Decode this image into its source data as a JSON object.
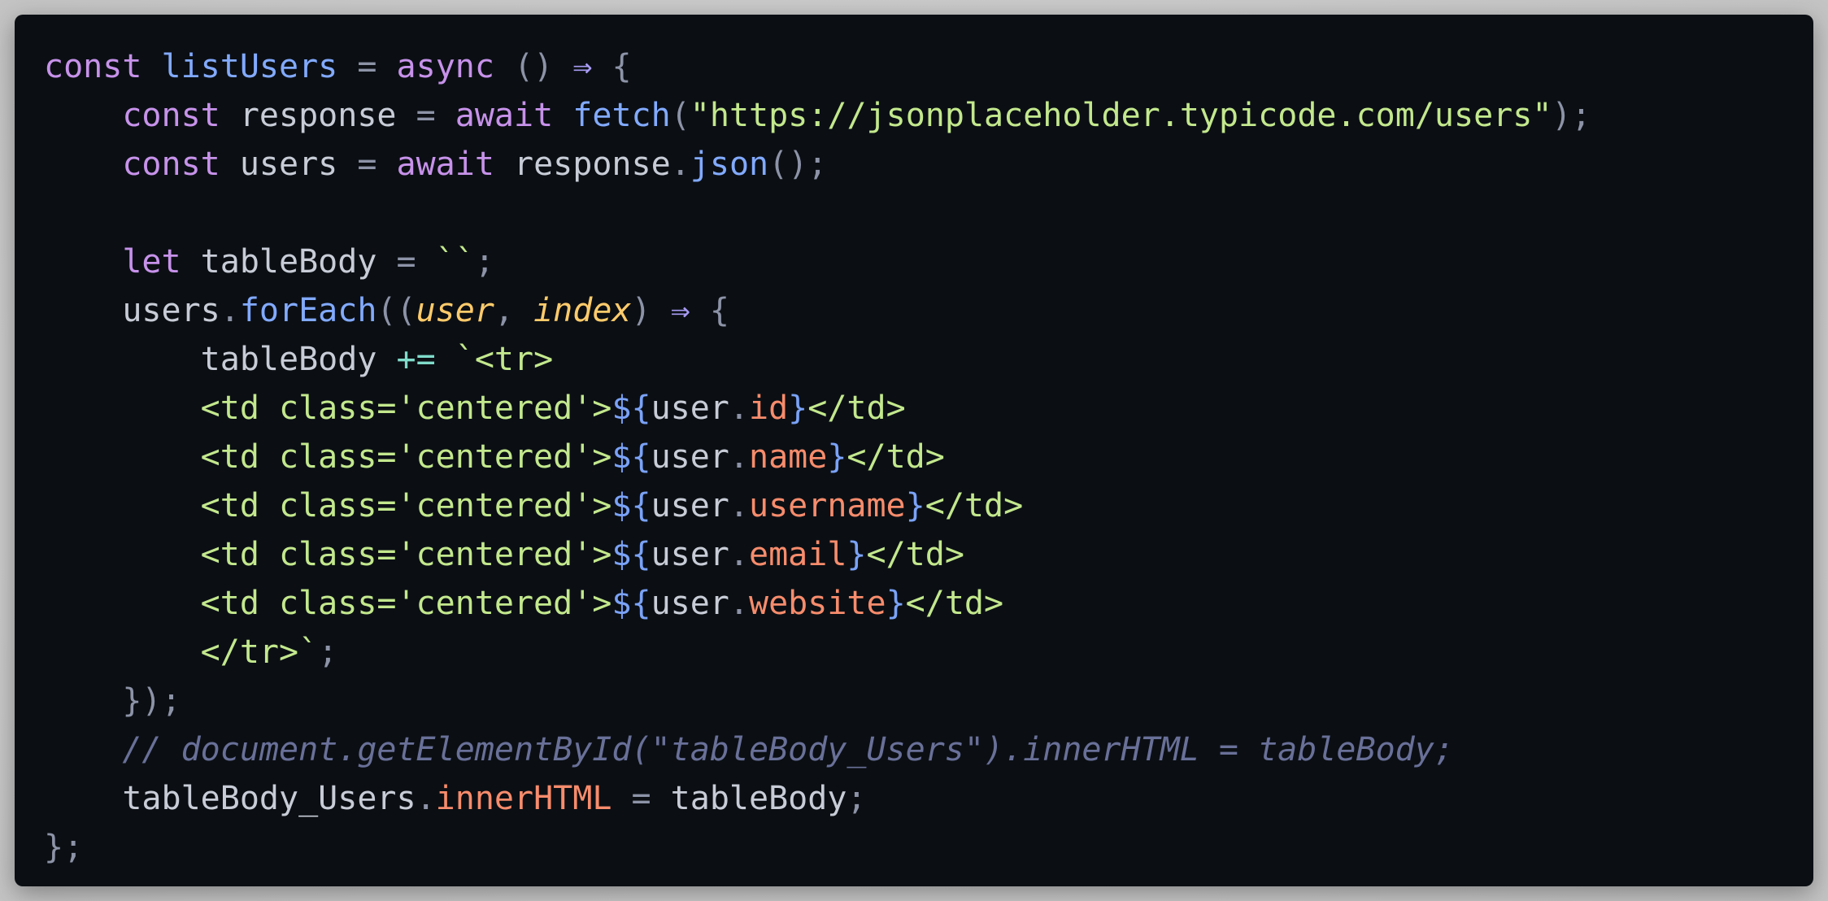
{
  "editor": {
    "language": "javascript",
    "colors": {
      "background": "#0b0f14",
      "keyword": "#c792ea",
      "function": "#82aaff",
      "string": "#c3e88d",
      "parameter": "#ffcb6b",
      "property": "#f78c6c",
      "comment": "#697098"
    },
    "lines": [
      [
        {
          "t": "kw",
          "v": "const"
        },
        {
          "t": "pl",
          "v": " "
        },
        {
          "t": "fn",
          "v": "listUsers"
        },
        {
          "t": "pl",
          "v": " "
        },
        {
          "t": "pun",
          "v": "="
        },
        {
          "t": "pl",
          "v": " "
        },
        {
          "t": "kw",
          "v": "async"
        },
        {
          "t": "pl",
          "v": " "
        },
        {
          "t": "pun",
          "v": "()"
        },
        {
          "t": "pl",
          "v": " "
        },
        {
          "t": "op",
          "v": "⇒"
        },
        {
          "t": "pl",
          "v": " "
        },
        {
          "t": "pun",
          "v": "{"
        }
      ],
      [
        {
          "t": "pl",
          "v": "    "
        },
        {
          "t": "kw",
          "v": "const"
        },
        {
          "t": "pl",
          "v": " response "
        },
        {
          "t": "pun",
          "v": "="
        },
        {
          "t": "pl",
          "v": " "
        },
        {
          "t": "kw",
          "v": "await"
        },
        {
          "t": "pl",
          "v": " "
        },
        {
          "t": "fn",
          "v": "fetch"
        },
        {
          "t": "pun",
          "v": "("
        },
        {
          "t": "str",
          "v": "\"https://jsonplaceholder.typicode.com/users\""
        },
        {
          "t": "pun",
          "v": ");"
        }
      ],
      [
        {
          "t": "pl",
          "v": "    "
        },
        {
          "t": "kw",
          "v": "const"
        },
        {
          "t": "pl",
          "v": " users "
        },
        {
          "t": "pun",
          "v": "="
        },
        {
          "t": "pl",
          "v": " "
        },
        {
          "t": "kw",
          "v": "await"
        },
        {
          "t": "pl",
          "v": " response"
        },
        {
          "t": "pun",
          "v": "."
        },
        {
          "t": "fn",
          "v": "json"
        },
        {
          "t": "pun",
          "v": "();"
        }
      ],
      [],
      [
        {
          "t": "pl",
          "v": "    "
        },
        {
          "t": "kw",
          "v": "let"
        },
        {
          "t": "pl",
          "v": " tableBody "
        },
        {
          "t": "pun",
          "v": "="
        },
        {
          "t": "pl",
          "v": " "
        },
        {
          "t": "str",
          "v": "``"
        },
        {
          "t": "pun",
          "v": ";"
        }
      ],
      [
        {
          "t": "pl",
          "v": "    users"
        },
        {
          "t": "pun",
          "v": "."
        },
        {
          "t": "fn",
          "v": "forEach"
        },
        {
          "t": "pun",
          "v": "(("
        },
        {
          "t": "prm",
          "v": "user"
        },
        {
          "t": "pun",
          "v": ", "
        },
        {
          "t": "prm",
          "v": "index"
        },
        {
          "t": "pun",
          "v": ")"
        },
        {
          "t": "pl",
          "v": " "
        },
        {
          "t": "op",
          "v": "⇒"
        },
        {
          "t": "pl",
          "v": " "
        },
        {
          "t": "pun",
          "v": "{"
        }
      ],
      [
        {
          "t": "pl",
          "v": "        tableBody "
        },
        {
          "t": "cyan",
          "v": "+="
        },
        {
          "t": "pl",
          "v": " "
        },
        {
          "t": "str",
          "v": "`<tr>"
        }
      ],
      [
        {
          "t": "pl",
          "v": "        "
        },
        {
          "t": "str",
          "v": "<td class='centered'>"
        },
        {
          "t": "tpl",
          "v": "${"
        },
        {
          "t": "pl",
          "v": "user"
        },
        {
          "t": "pun",
          "v": "."
        },
        {
          "t": "prop",
          "v": "id"
        },
        {
          "t": "tpl",
          "v": "}"
        },
        {
          "t": "str",
          "v": "</td>"
        }
      ],
      [
        {
          "t": "pl",
          "v": "        "
        },
        {
          "t": "str",
          "v": "<td class='centered'>"
        },
        {
          "t": "tpl",
          "v": "${"
        },
        {
          "t": "pl",
          "v": "user"
        },
        {
          "t": "pun",
          "v": "."
        },
        {
          "t": "prop",
          "v": "name"
        },
        {
          "t": "tpl",
          "v": "}"
        },
        {
          "t": "str",
          "v": "</td>"
        }
      ],
      [
        {
          "t": "pl",
          "v": "        "
        },
        {
          "t": "str",
          "v": "<td class='centered'>"
        },
        {
          "t": "tpl",
          "v": "${"
        },
        {
          "t": "pl",
          "v": "user"
        },
        {
          "t": "pun",
          "v": "."
        },
        {
          "t": "prop",
          "v": "username"
        },
        {
          "t": "tpl",
          "v": "}"
        },
        {
          "t": "str",
          "v": "</td>"
        }
      ],
      [
        {
          "t": "pl",
          "v": "        "
        },
        {
          "t": "str",
          "v": "<td class='centered'>"
        },
        {
          "t": "tpl",
          "v": "${"
        },
        {
          "t": "pl",
          "v": "user"
        },
        {
          "t": "pun",
          "v": "."
        },
        {
          "t": "prop",
          "v": "email"
        },
        {
          "t": "tpl",
          "v": "}"
        },
        {
          "t": "str",
          "v": "</td>"
        }
      ],
      [
        {
          "t": "pl",
          "v": "        "
        },
        {
          "t": "str",
          "v": "<td class='centered'>"
        },
        {
          "t": "tpl",
          "v": "${"
        },
        {
          "t": "pl",
          "v": "user"
        },
        {
          "t": "pun",
          "v": "."
        },
        {
          "t": "prop",
          "v": "website"
        },
        {
          "t": "tpl",
          "v": "}"
        },
        {
          "t": "str",
          "v": "</td>"
        }
      ],
      [
        {
          "t": "pl",
          "v": "        "
        },
        {
          "t": "str",
          "v": "</tr>`"
        },
        {
          "t": "pun",
          "v": ";"
        }
      ],
      [
        {
          "t": "pl",
          "v": "    "
        },
        {
          "t": "pun",
          "v": "});"
        }
      ],
      [
        {
          "t": "pl",
          "v": "    "
        },
        {
          "t": "com",
          "v": "// document.getElementById(\"tableBody_Users\").innerHTML = tableBody;"
        }
      ],
      [
        {
          "t": "pl",
          "v": "    tableBody_Users"
        },
        {
          "t": "pun",
          "v": "."
        },
        {
          "t": "prop",
          "v": "innerHTML"
        },
        {
          "t": "pl",
          "v": " "
        },
        {
          "t": "pun",
          "v": "="
        },
        {
          "t": "pl",
          "v": " tableBody"
        },
        {
          "t": "pun",
          "v": ";"
        }
      ],
      [
        {
          "t": "pun",
          "v": "};"
        }
      ]
    ]
  }
}
